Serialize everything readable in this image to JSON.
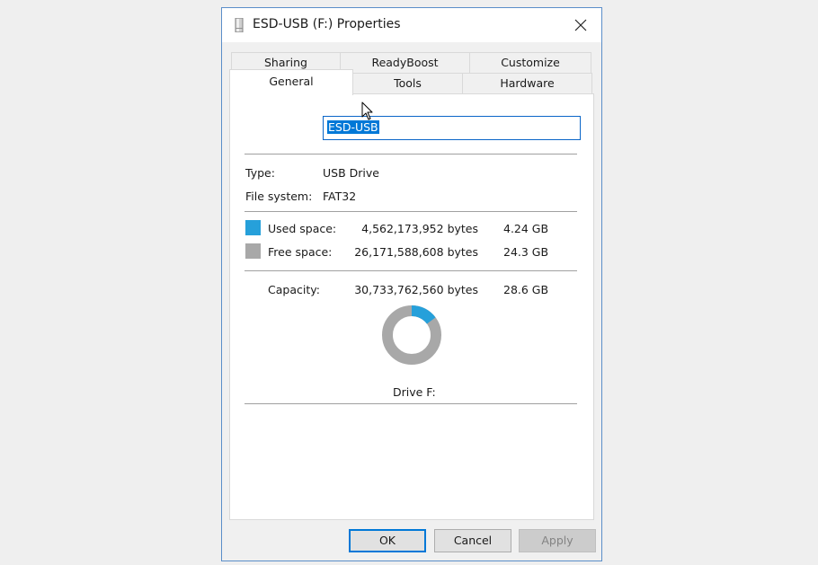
{
  "window": {
    "title": "ESD-USB (F:) Properties"
  },
  "tabs": {
    "row1": [
      "Sharing",
      "ReadyBoost",
      "Customize"
    ],
    "row2": [
      "General",
      "Tools",
      "Hardware"
    ],
    "active": "General"
  },
  "general": {
    "volume_name": "ESD-USB",
    "type_label": "Type:",
    "type_value": "USB Drive",
    "fs_label": "File system:",
    "fs_value": "FAT32",
    "used_label": "Used space:",
    "used_bytes": "4,562,173,952 bytes",
    "used_gb": "4.24 GB",
    "free_label": "Free space:",
    "free_bytes": "26,171,588,608 bytes",
    "free_gb": "24.3 GB",
    "capacity_label": "Capacity:",
    "capacity_bytes": "30,733,762,560 bytes",
    "capacity_gb": "28.6 GB",
    "drive_label": "Drive F:",
    "used_fraction": 0.1484
  },
  "colors": {
    "used": "#26a0da",
    "free": "#a8a8a8"
  },
  "buttons": {
    "ok": "OK",
    "cancel": "Cancel",
    "apply": "Apply"
  },
  "icons": {
    "window": "usb-drive-icon",
    "close": "close-icon",
    "pointer": "mouse-cursor-icon"
  }
}
